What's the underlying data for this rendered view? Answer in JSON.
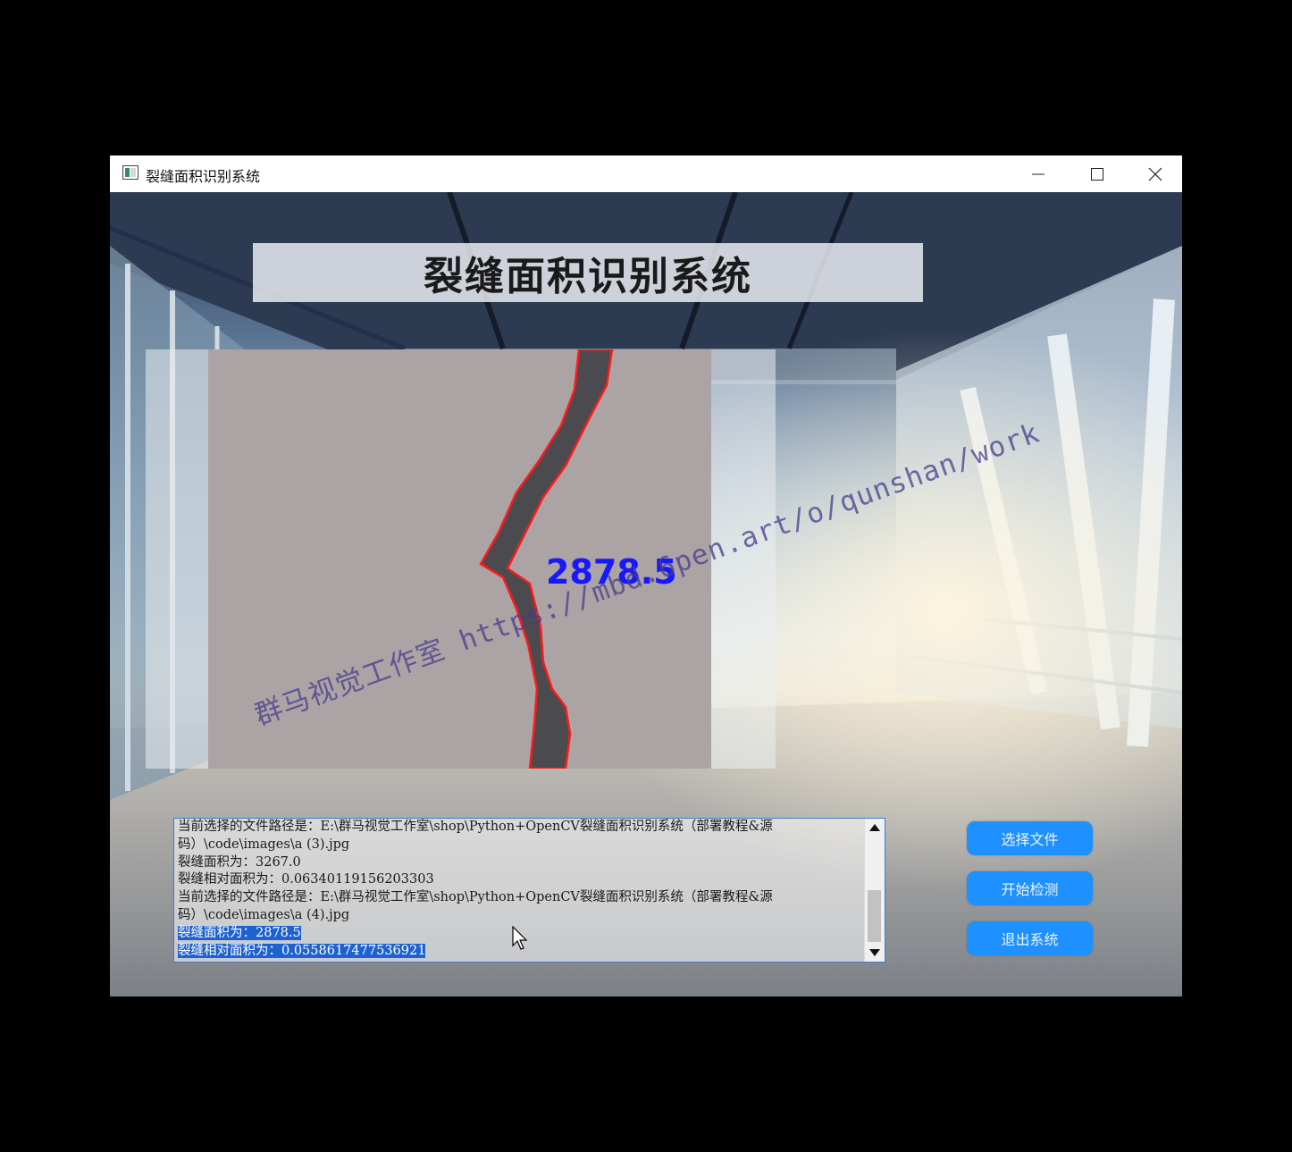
{
  "window": {
    "title": "裂缝面积识别系统"
  },
  "header": {
    "banner_title": "裂缝面积识别系统"
  },
  "image_panel": {
    "overlay_label": "2878.5"
  },
  "log": {
    "lines": [
      "当前选择的文件路径是：E:\\群马视觉工作室\\shop\\Python+OpenCV裂缝面积识别系统（部署教程&源",
      "码）\\code\\images\\a (3).jpg",
      "裂缝面积为：3267.0",
      "裂缝相对面积为：0.06340119156203303",
      "当前选择的文件路径是：E:\\群马视觉工作室\\shop\\Python+OpenCV裂缝面积识别系统（部署教程&源",
      "码）\\code\\images\\a (4).jpg",
      "裂缝面积为：2878.5",
      "裂缝相对面积为：0.0558617477536921"
    ]
  },
  "buttons": {
    "select_file": "选择文件",
    "start_detect": "开始检测",
    "exit_system": "退出系统"
  },
  "watermark": {
    "text": "群马视觉工作室 https://mbd.6pen.art/o/qunshan/work"
  }
}
